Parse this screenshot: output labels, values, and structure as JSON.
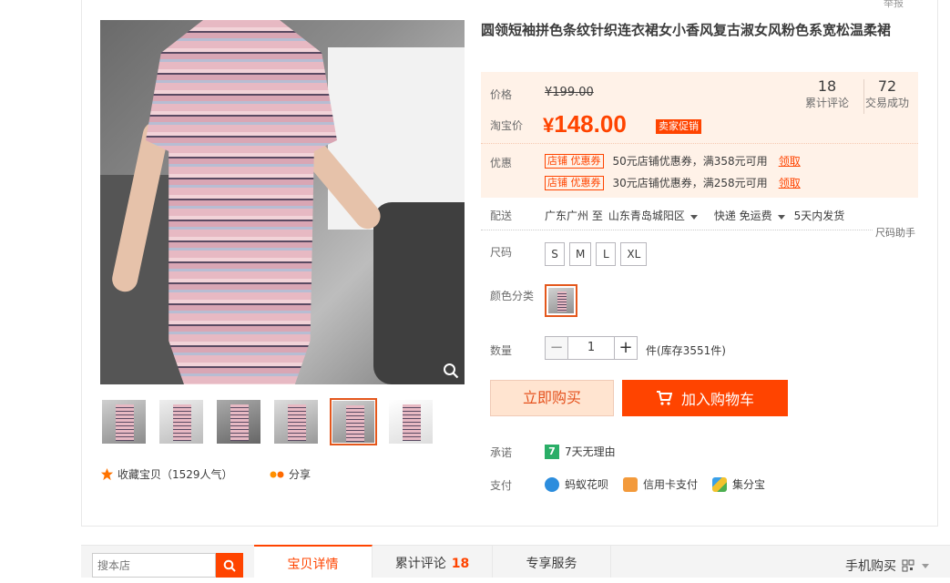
{
  "report_label": "举报",
  "product": {
    "title": "圆领短袖拼色条纹针织连衣裙女小香风复古淑女风粉色系宽松温柔裙"
  },
  "price": {
    "label": "价格",
    "original": "¥199.00",
    "taobao_label": "淘宝价",
    "current_symbol": "¥",
    "current": "148.00",
    "promo_tag": "卖家促销",
    "accent_color": "#ff4400"
  },
  "stats": {
    "reviews_count": "18",
    "reviews_label": "累计评论",
    "sales_count": "72",
    "sales_label": "交易成功"
  },
  "promotions": {
    "label": "优惠",
    "coupons": [
      {
        "tag": "店铺 优惠券",
        "text": "50元店铺优惠券，满358元可用",
        "link": "领取"
      },
      {
        "tag": "店铺 优惠券",
        "text": "30元店铺优惠券，满258元可用",
        "link": "领取"
      }
    ]
  },
  "shipping": {
    "label": "配送",
    "from": "广东广州 至",
    "to": "山东青岛城阳区",
    "method": "快递 免运费",
    "dispatch": "5天内发货"
  },
  "size": {
    "label": "尺码",
    "helper": "尺码助手",
    "options": [
      "S",
      "M",
      "L",
      "XL"
    ]
  },
  "color": {
    "label": "颜色分类"
  },
  "quantity": {
    "label": "数量",
    "minus": "−",
    "plus": "+",
    "value": "1",
    "stock": "件(库存3551件)"
  },
  "actions": {
    "buy_now": "立即购买",
    "add_cart": "加入购物车"
  },
  "promise": {
    "label": "承诺",
    "badge": "7",
    "text": "7天无理由"
  },
  "payment": {
    "label": "支付",
    "methods": [
      "蚂蚁花呗",
      "信用卡支付",
      "集分宝"
    ]
  },
  "gallery": {
    "collect": "收藏宝贝（1529人气）",
    "share": "分享"
  },
  "bottom": {
    "search_placeholder": "搜本店",
    "tabs": [
      "宝贝详情",
      "累计评论",
      "专享服务"
    ],
    "review_count": "18",
    "mobile_buy": "手机购买"
  }
}
